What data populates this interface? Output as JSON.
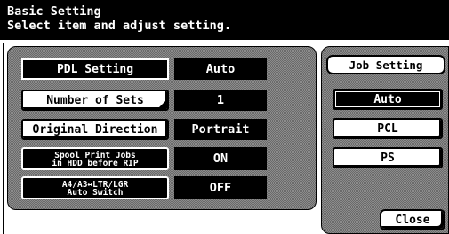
{
  "header": {
    "title": "Basic Setting",
    "instruction": "Select item and adjust setting."
  },
  "settings": {
    "pdl_setting": {
      "label": "PDL Setting",
      "value": "Auto"
    },
    "number_of_sets": {
      "label": "Number of Sets",
      "value": "1"
    },
    "original_direction": {
      "label": "Original Direction",
      "value": "Portrait"
    },
    "spool_print_jobs": {
      "label_line1": "Spool Print Jobs",
      "label_line2": "in HDD before RIP",
      "value": "ON"
    },
    "paper_auto_switch": {
      "label_line1": "A4/A3↔LTR/LGR",
      "label_line2": "Auto Switch",
      "value": "OFF"
    }
  },
  "job_setting": {
    "title": "Job Setting",
    "options": [
      {
        "label": "Auto",
        "selected": true
      },
      {
        "label": "PCL",
        "selected": false
      },
      {
        "label": "PS",
        "selected": false
      }
    ]
  },
  "close_button": {
    "label": "Close"
  }
}
